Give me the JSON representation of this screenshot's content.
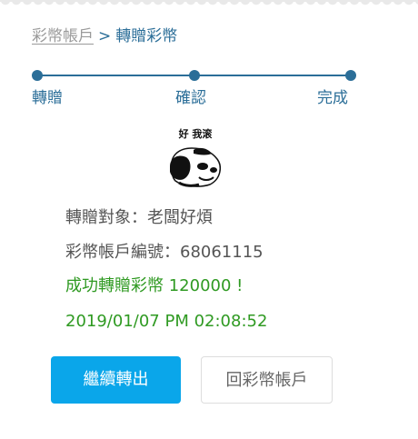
{
  "breadcrumb": {
    "parent": "彩幣帳戶",
    "separator": ">",
    "current": "轉贈彩幣"
  },
  "steps": [
    {
      "label": "轉贈"
    },
    {
      "label": "確認"
    },
    {
      "label": "完成"
    }
  ],
  "sticker": {
    "caption": "好 我滚",
    "icon": "panda-meme-sticker"
  },
  "result": {
    "recipient": "轉贈對象：老闆好煩",
    "account": "彩幣帳戶編號：68061115",
    "success": "成功轉贈彩幣 120000 !",
    "timestamp": "2019/01/07 PM 02:08:52"
  },
  "buttons": {
    "continue": "繼續轉出",
    "back": "回彩幣帳戶"
  },
  "colors": {
    "accent_blue": "#2b6e98",
    "button_blue": "#0aa6ea",
    "success_green": "#2f9a22"
  }
}
